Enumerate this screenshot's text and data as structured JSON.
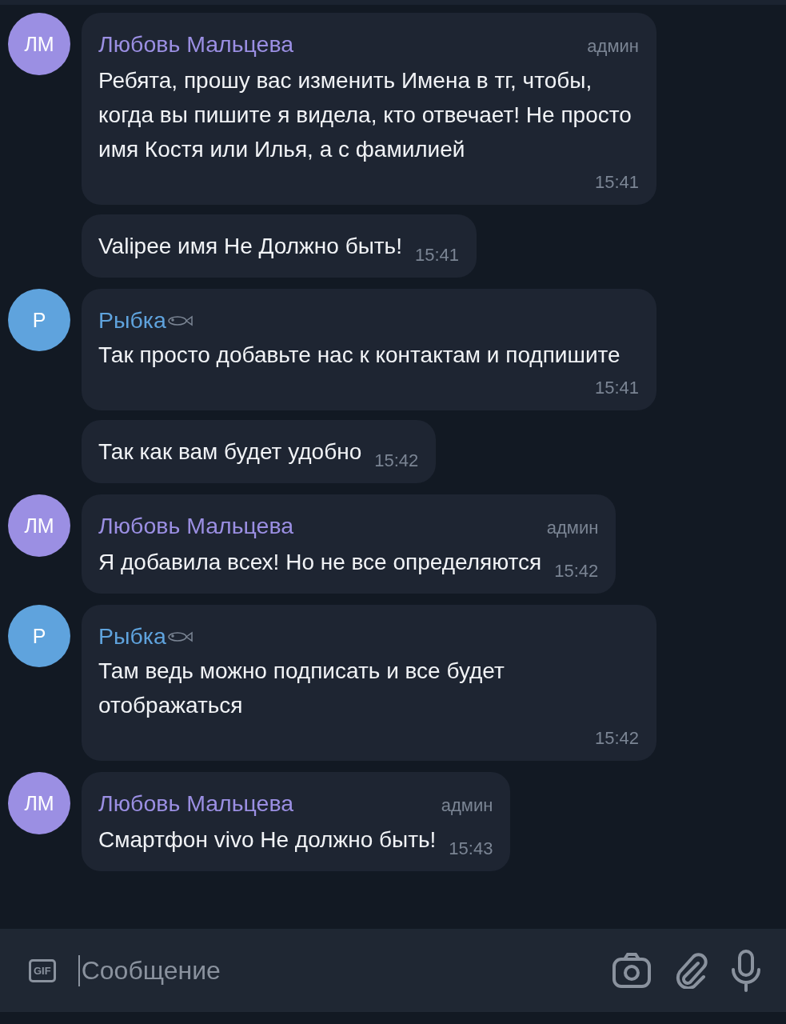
{
  "groups": [
    {
      "initials": "ЛМ",
      "name": "Любовь Мальцева",
      "color": "#9b8fe3",
      "badge": "админ",
      "fish": false,
      "messages": [
        {
          "text": "Ребята, прошу вас изменить Имена в тг, чтобы, когда вы пишите я видела, кто отвечает! Не просто имя Костя или Илья, а с фамилией",
          "time": "15:41"
        },
        {
          "text": "Valipee имя Не Должно быть!",
          "time": "15:41"
        }
      ]
    },
    {
      "initials": "Р",
      "name": "Рыбка",
      "color": "#5fa3dd",
      "fish": true,
      "messages": [
        {
          "text": "Так просто добавьте нас к контактам и подпишите",
          "time": "15:41"
        },
        {
          "text": "Так как вам будет удобно",
          "time": "15:42"
        }
      ]
    },
    {
      "initials": "ЛМ",
      "name": "Любовь Мальцева",
      "color": "#9b8fe3",
      "badge": "админ",
      "fish": false,
      "messages": [
        {
          "text": "Я добавила всех! Но не все определяются",
          "time": "15:42"
        }
      ]
    },
    {
      "initials": "Р",
      "name": "Рыбка",
      "color": "#5fa3dd",
      "fish": true,
      "messages": [
        {
          "text": "Там ведь можно подписать и все будет отображаться",
          "time": "15:42"
        }
      ]
    },
    {
      "initials": "ЛМ",
      "name": "Любовь Мальцева",
      "color": "#9b8fe3",
      "badge": "админ",
      "fish": false,
      "messages": [
        {
          "text": "Смартфон vivo Не должно быть!",
          "time": "15:43"
        }
      ]
    }
  ],
  "composer": {
    "gif": "GIF",
    "placeholder": "Сообщение"
  }
}
